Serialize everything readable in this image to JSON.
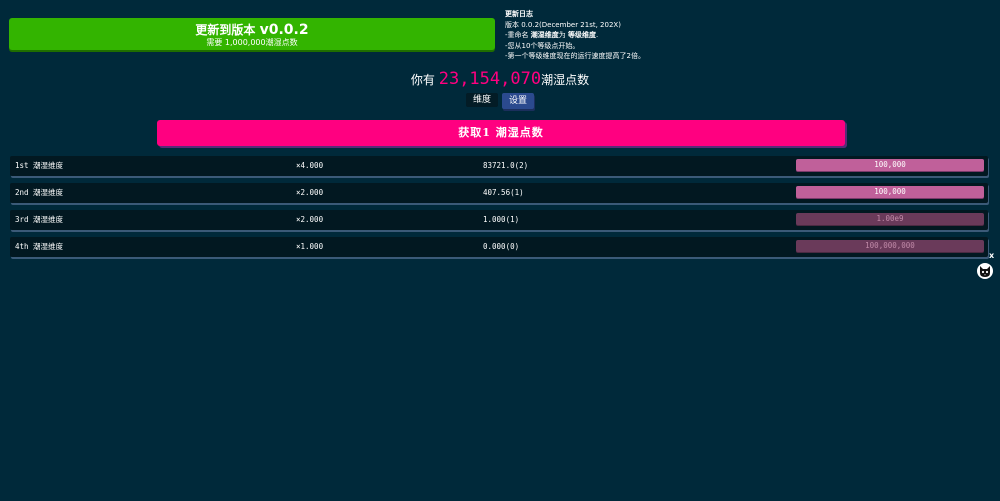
{
  "update": {
    "title_prefix": "更新到版本 ",
    "version": "v0.0.2",
    "requirement": "需要 1,000,000潮湿点数"
  },
  "changelog": {
    "title": "更新日志",
    "version_line": "版本 0.0.2(December 21st, 202X)",
    "line1_prefix": "-重命名 ",
    "line1_old": "潮湿维度",
    "line1_mid": "为 ",
    "line1_new": "等级维度",
    "line1_end": ".",
    "line2": "-您从10个等级点开始。",
    "line3": "-第一个等级维度现在的运行速度提高了2倍。"
  },
  "points": {
    "prefix": "你有 ",
    "value": "23,154,070",
    "suffix": "潮湿点数"
  },
  "tabs": {
    "dimensions": "维度",
    "settings": "设置"
  },
  "gain_button": "获取1 潮湿点数",
  "dimensions": [
    {
      "name": "1st 潮湿维度",
      "mult": "×4.000",
      "amount": "83721.0(2)",
      "cost": "100,000",
      "affordable": true
    },
    {
      "name": "2nd 潮湿维度",
      "mult": "×2.000",
      "amount": "407.56(1)",
      "cost": "100,000",
      "affordable": true
    },
    {
      "name": "3rd 潮湿维度",
      "mult": "×2.000",
      "amount": "1.000(1)",
      "cost": "1.00e9",
      "affordable": false
    },
    {
      "name": "4th 潮湿维度",
      "mult": "×1.000",
      "amount": "0.000(0)",
      "cost": "100,000,000",
      "affordable": false
    }
  ],
  "close_label": "x",
  "icons": {
    "avatar": "cat-avatar-icon"
  },
  "colors": {
    "background": "#00293a",
    "update_green": "#33b400",
    "accent_pink": "#ff0080",
    "settings_blue": "#2b4a8e"
  }
}
